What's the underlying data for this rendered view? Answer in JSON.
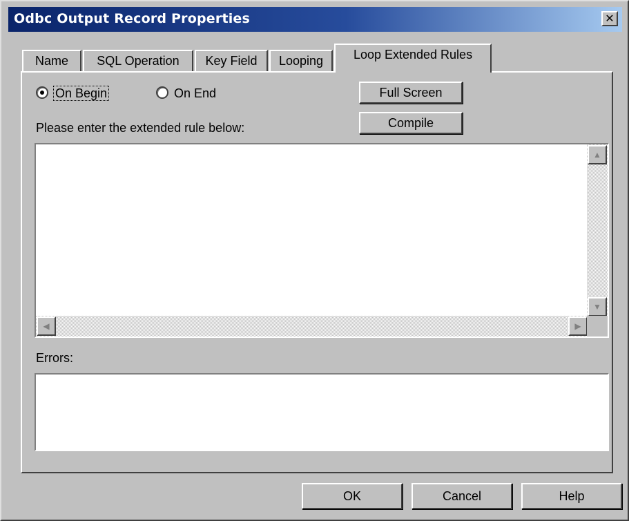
{
  "window": {
    "title": "Odbc Output Record Properties",
    "close_glyph": "✕"
  },
  "tabs": [
    {
      "label": "Name"
    },
    {
      "label": "SQL Operation"
    },
    {
      "label": "Key Field"
    },
    {
      "label": "Looping"
    },
    {
      "label": "Loop Extended Rules",
      "active": true
    }
  ],
  "options": {
    "on_begin": {
      "label": "On Begin",
      "checked": true
    },
    "on_end": {
      "label": "On End",
      "checked": false
    }
  },
  "buttons": {
    "full_screen": "Full Screen",
    "compile": "Compile",
    "ok": "OK",
    "cancel": "Cancel",
    "help": "Help"
  },
  "editor": {
    "prompt": "Please enter the extended rule below:",
    "value": ""
  },
  "errors": {
    "label": "Errors:",
    "value": ""
  },
  "icons": [
    "close-icon",
    "scroll-up-icon",
    "scroll-down-icon",
    "scroll-left-icon",
    "scroll-right-icon"
  ],
  "colors": {
    "title_bar_start": "#0a246a",
    "title_bar_end": "#a6caf0",
    "face": "#c0c0c0"
  }
}
